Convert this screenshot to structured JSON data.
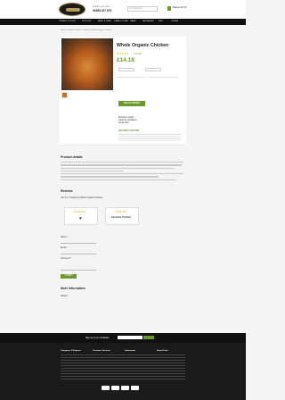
{
  "header": {
    "phone_label": "Speak to our team",
    "phone": "01885 427 679",
    "search_placeholder": "I'm looking for...",
    "basket_label": "Basket £0.00"
  },
  "nav": [
    "TURKEY & DUCK",
    "POULTRY",
    "BEEF & VEAL",
    "LAMB & PORK",
    "GAME",
    "SAUSAGES",
    "DELI",
    "OTHER"
  ],
  "breadcrumb": "Home / Poultry & Game / Chicken / Whole Organic Chicken",
  "product": {
    "title": "Whole Organic Chicken",
    "reviews_link": "1 review",
    "price": "£14.18",
    "add_to_basket": "ADD TO BASKET",
    "delivery_label": "DELIVERY OPTIONS",
    "bullets": [
      "Excellent quality",
      "Carefully packaged",
      "Great price"
    ]
  },
  "details": {
    "heading": "Product details"
  },
  "reviews": {
    "heading": "Reviews",
    "summary": "Our 5.0 / 5 rating for Whole Organic Chicken",
    "card2_title": "Excellent Product"
  },
  "form": {
    "name_label": "Name *",
    "email_label": "Email *",
    "comment_label": "Comment *",
    "submit": "SUBMIT REVIEW"
  },
  "more": {
    "heading": "More Information",
    "row_label": "Weight"
  },
  "footer": {
    "newsletter": "Sign up to our newsletter",
    "col1_title": "Categories & Regions",
    "col2_title": "Customer Services",
    "col3_title": "Information",
    "col4_title": "Social Links"
  }
}
